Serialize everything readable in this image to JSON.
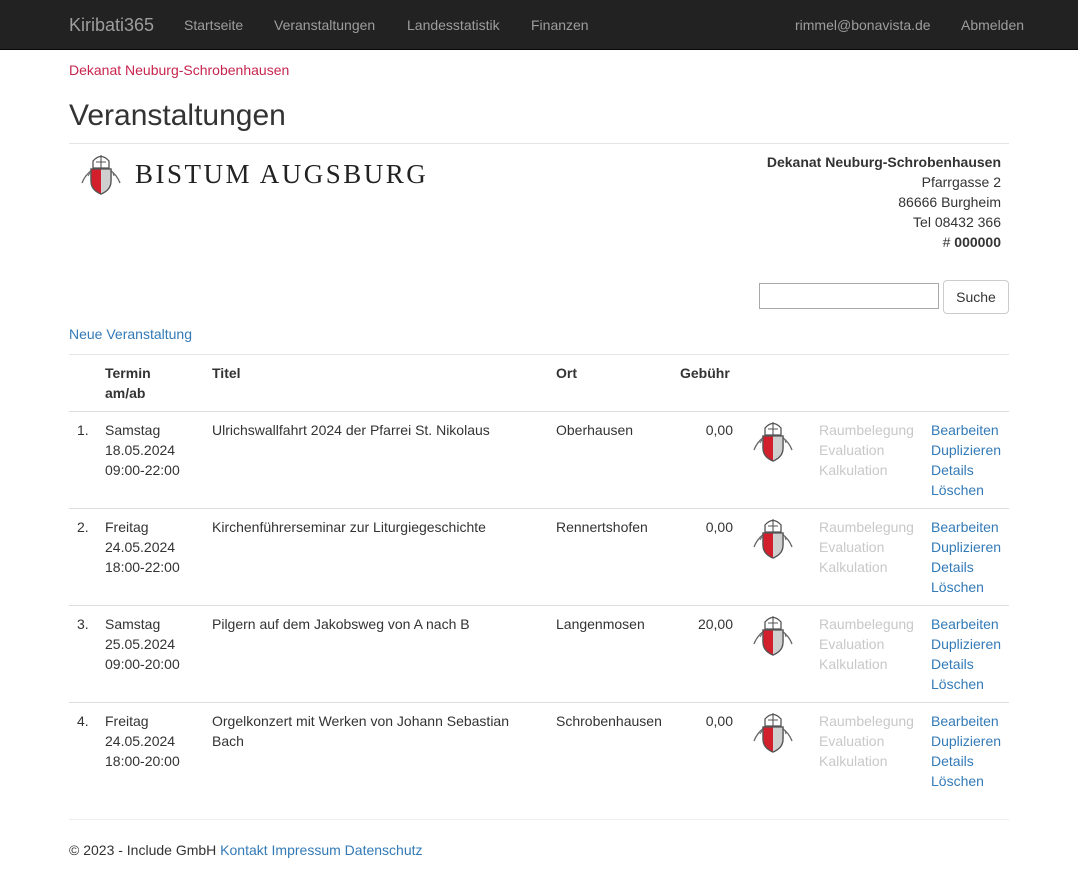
{
  "navbar": {
    "brand": "Kiribati365",
    "items": [
      "Startseite",
      "Veranstaltungen",
      "Landesstatistik",
      "Finanzen"
    ],
    "user": "rimmel@bonavista.de",
    "logout": "Abmelden"
  },
  "dekanat_link": "Dekanat Neuburg-Schrobenhausen",
  "page_title": "Veranstaltungen",
  "logo_text": "BISTUM AUGSBURG",
  "address": {
    "name": "Dekanat Neuburg-Schrobenhausen",
    "street": "Pfarrgasse 2",
    "city": "86666 Burgheim",
    "phone": "Tel 08432 366",
    "number_prefix": "# ",
    "number": "000000"
  },
  "search": {
    "value": "",
    "button": "Suche"
  },
  "new_event": "Neue Veranstaltung",
  "table": {
    "headers": {
      "termin_1": "Termin",
      "termin_2": "am/ab",
      "titel": "Titel",
      "ort": "Ort",
      "gebuehr": "Gebühr"
    },
    "rows": [
      {
        "nr": "1.",
        "day": "Samstag",
        "date": "18.05.2024",
        "time": "09:00-22:00",
        "title": "Ulrichswallfahrt 2024 der Pfarrei St. Nikolaus",
        "place": "Oberhausen",
        "fee": "0,00"
      },
      {
        "nr": "2.",
        "day": "Freitag",
        "date": "24.05.2024",
        "time": "18:00-22:00",
        "title": "Kirchenführerseminar zur Liturgiegeschichte",
        "place": "Rennertshofen",
        "fee": "0,00"
      },
      {
        "nr": "3.",
        "day": "Samstag",
        "date": "25.05.2024",
        "time": "09:00-20:00",
        "title": "Pilgern auf dem Jakobsweg von A nach B",
        "place": "Langenmosen",
        "fee": "20,00"
      },
      {
        "nr": "4.",
        "day": "Freitag",
        "date": "24.05.2024",
        "time": "18:00-20:00",
        "title": "Orgelkonzert mit Werken von Johann Sebastian Bach",
        "place": "Schrobenhausen",
        "fee": "0,00"
      }
    ],
    "disabled_links": [
      "Raumbelegung",
      "Evaluation",
      "Kalkulation"
    ],
    "actions": [
      "Bearbeiten",
      "Duplizieren",
      "Details",
      "Löschen"
    ]
  },
  "footer": {
    "copyright": "© 2023 - Include GmbH",
    "links": [
      "Kontakt",
      "Impressum",
      "Datenschutz"
    ]
  },
  "colors": {
    "navbar_bg": "#222222",
    "nav_text": "#9d9d9d",
    "link": "#337ab7",
    "dekanat": "#c7254e",
    "muted": "#c8c8c8"
  },
  "icons": {
    "coat_of_arms": "bistum-coat-of-arms-icon"
  }
}
